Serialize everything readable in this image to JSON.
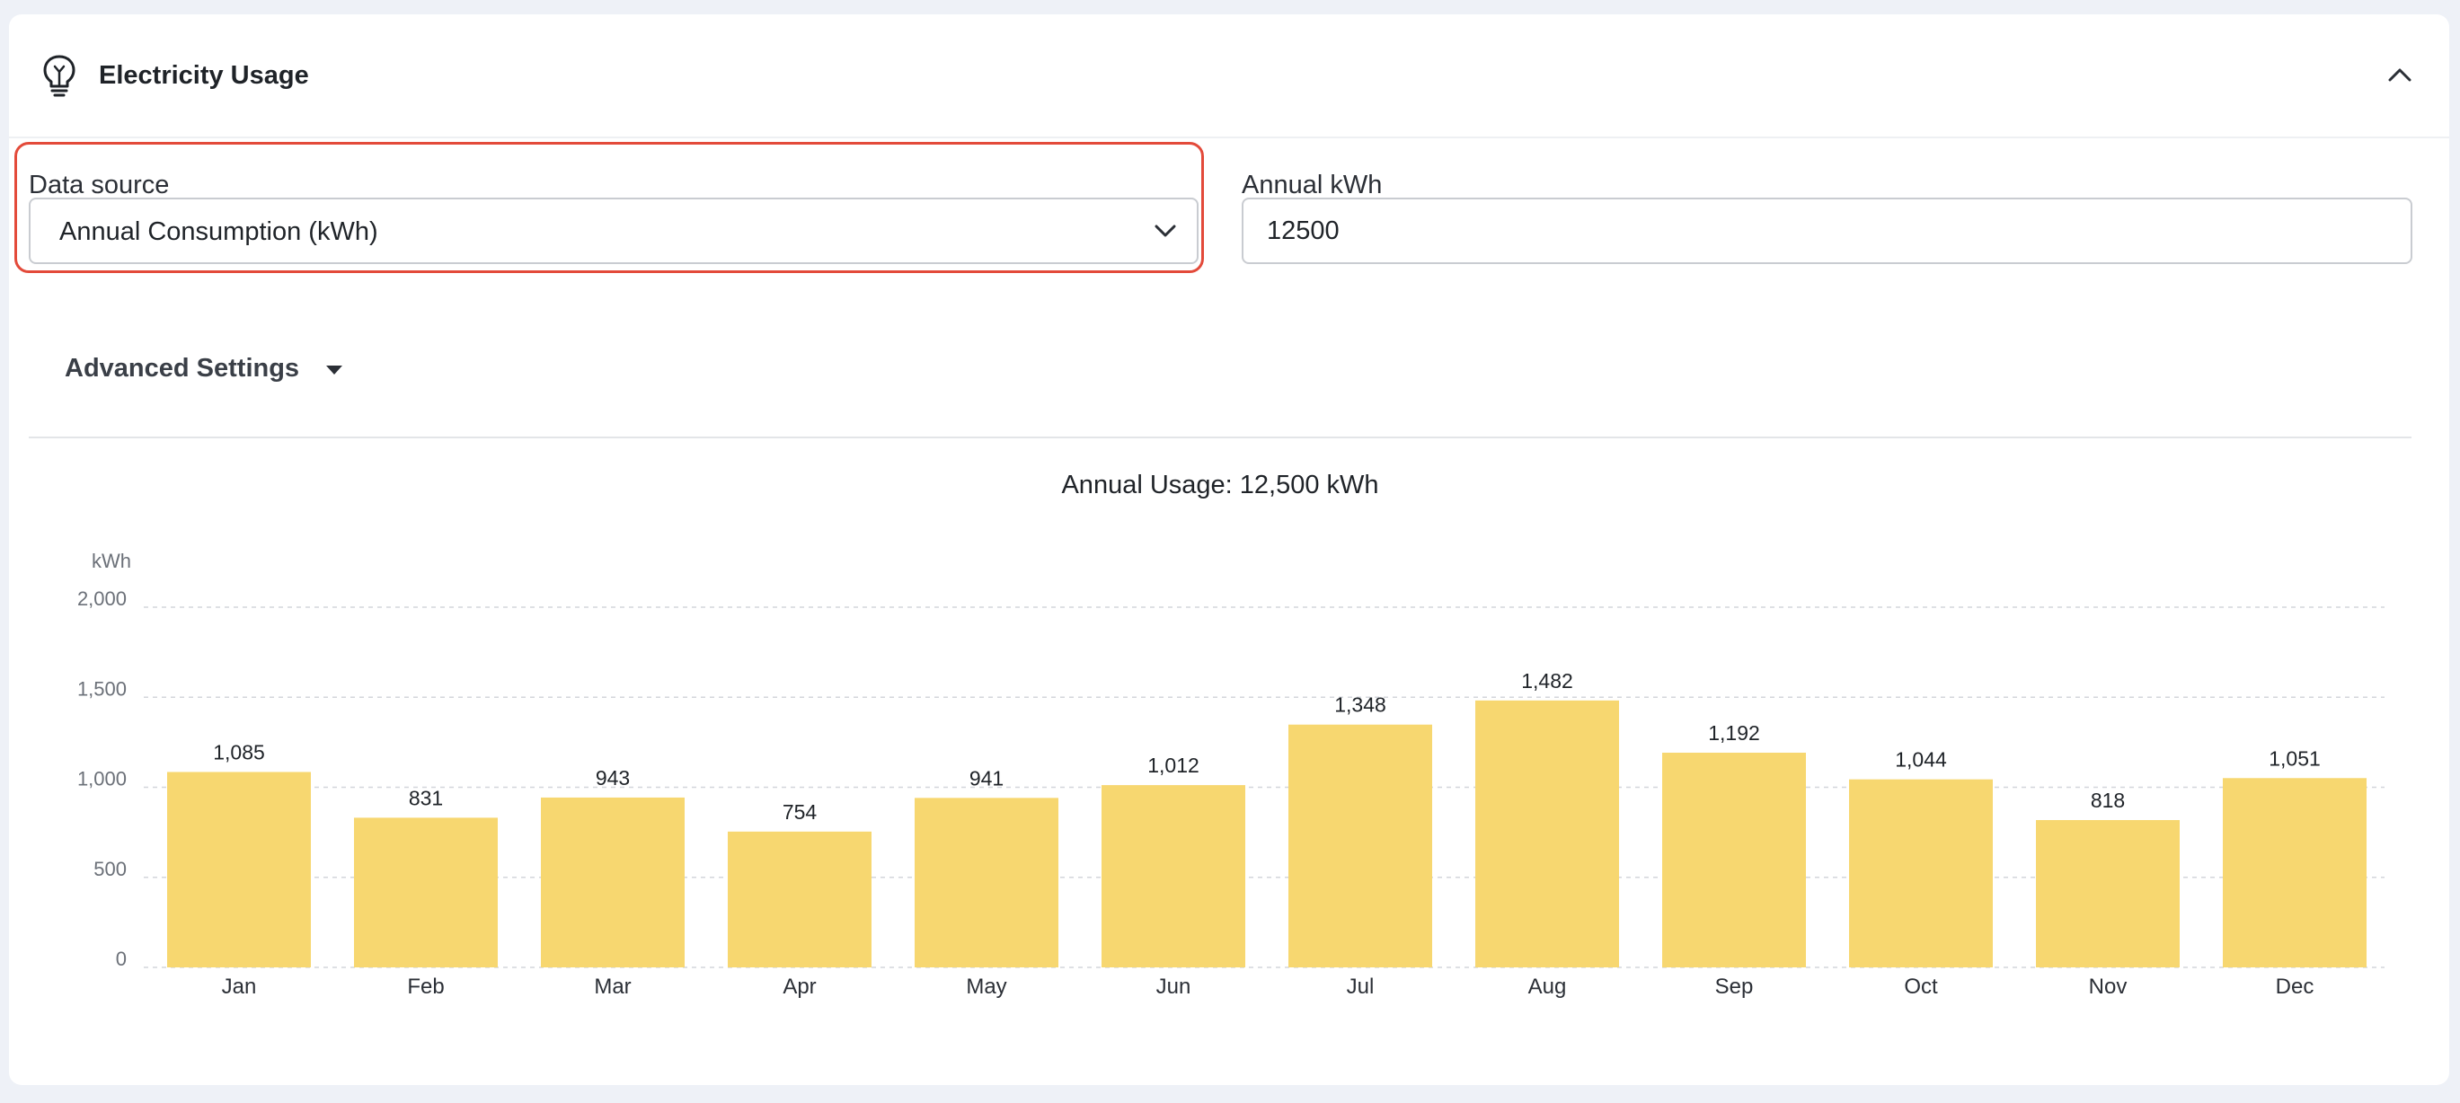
{
  "panel": {
    "title": "Electricity Usage",
    "icon": "lightbulb-icon",
    "collapse_icon": "chevron-up-icon"
  },
  "data_source": {
    "label": "Data source",
    "selected": "Annual Consumption (kWh)"
  },
  "annual_kwh": {
    "label": "Annual kWh",
    "value": "12500"
  },
  "advanced_settings": {
    "label": "Advanced Settings"
  },
  "colors": {
    "bar": "#f7d770",
    "highlight_border": "#e34a3a"
  },
  "chart_data": {
    "type": "bar",
    "title": "Annual Usage: 12,500 kWh",
    "ylabel": "kWh",
    "ylim": [
      0,
      2000
    ],
    "yticks": [
      0,
      500,
      1000,
      1500,
      2000
    ],
    "ytick_labels": [
      "0",
      "500",
      "1,000",
      "1,500",
      "2,000"
    ],
    "categories": [
      "Jan",
      "Feb",
      "Mar",
      "Apr",
      "May",
      "Jun",
      "Jul",
      "Aug",
      "Sep",
      "Oct",
      "Nov",
      "Dec"
    ],
    "values": [
      1085,
      831,
      943,
      754,
      941,
      1012,
      1348,
      1482,
      1192,
      1044,
      818,
      1051
    ],
    "value_labels": [
      "1,085",
      "831",
      "943",
      "754",
      "941",
      "1,012",
      "1,348",
      "1,482",
      "1,192",
      "1,044",
      "818",
      "1,051"
    ],
    "grid": true,
    "legend": "none"
  }
}
